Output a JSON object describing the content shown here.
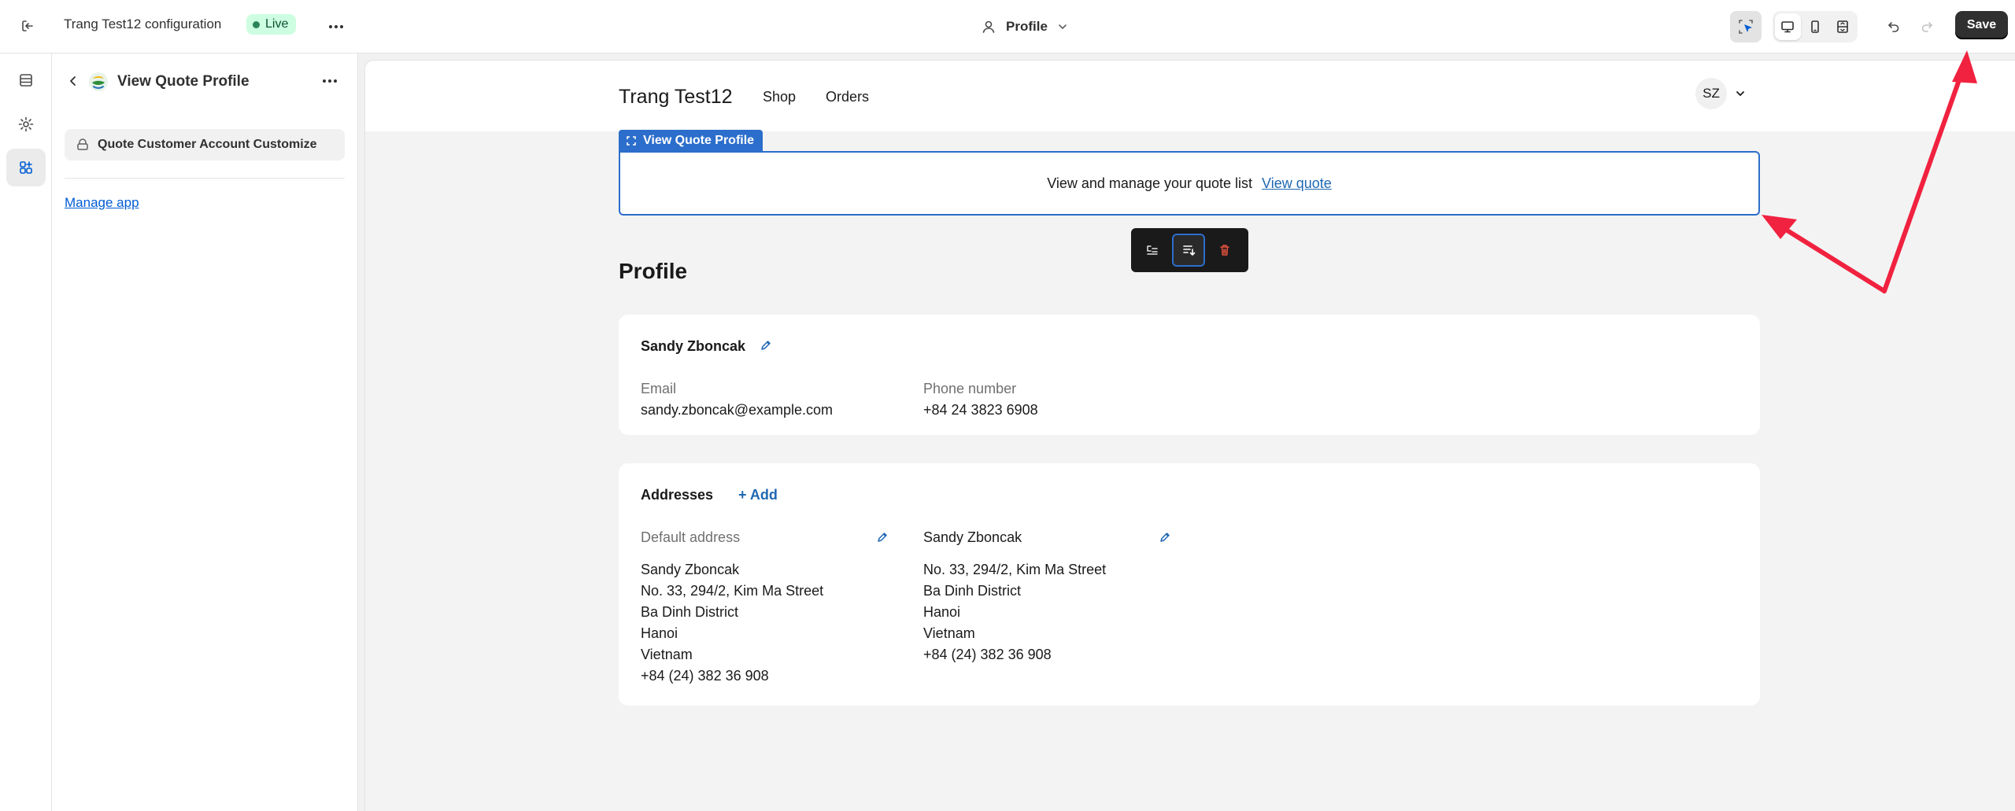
{
  "topbar": {
    "app_title": "Trang Test12 configuration",
    "live_badge": "Live",
    "page_select": "Profile",
    "save_label": "Save"
  },
  "panel": {
    "title": "View Quote Profile",
    "block_item": "Quote Customer Account Customize",
    "manage_link": "Manage app"
  },
  "store": {
    "name": "Trang Test12",
    "nav": [
      "Shop",
      "Orders"
    ],
    "avatar_initials": "SZ"
  },
  "quote_block": {
    "label": "View Quote Profile",
    "text": "View and manage your quote list",
    "link": "View quote"
  },
  "profile": {
    "heading": "Profile",
    "customer_name": "Sandy Zboncak",
    "email_label": "Email",
    "email_value": "sandy.zboncak@example.com",
    "phone_label": "Phone number",
    "phone_value": "+84 24 3823 6908"
  },
  "addresses": {
    "title": "Addresses",
    "add_label": "+ Add",
    "items": [
      {
        "heading": "Default address",
        "lines": [
          "Sandy Zboncak",
          "No. 33, 294/2, Kim Ma Street",
          "Ba Dinh District",
          "Hanoi",
          "Vietnam",
          "+84 (24) 382 36 908"
        ]
      },
      {
        "heading": "Sandy Zboncak",
        "lines": [
          "No. 33, 294/2, Kim Ma Street",
          "Ba Dinh District",
          "Hanoi",
          "Vietnam",
          "+84 (24) 382 36 908"
        ]
      }
    ]
  },
  "colors": {
    "accent_blue": "#2c6ecb",
    "link_blue": "#1f67b1",
    "annotation_red": "#f0223f",
    "live_green": "#cdfee1"
  }
}
